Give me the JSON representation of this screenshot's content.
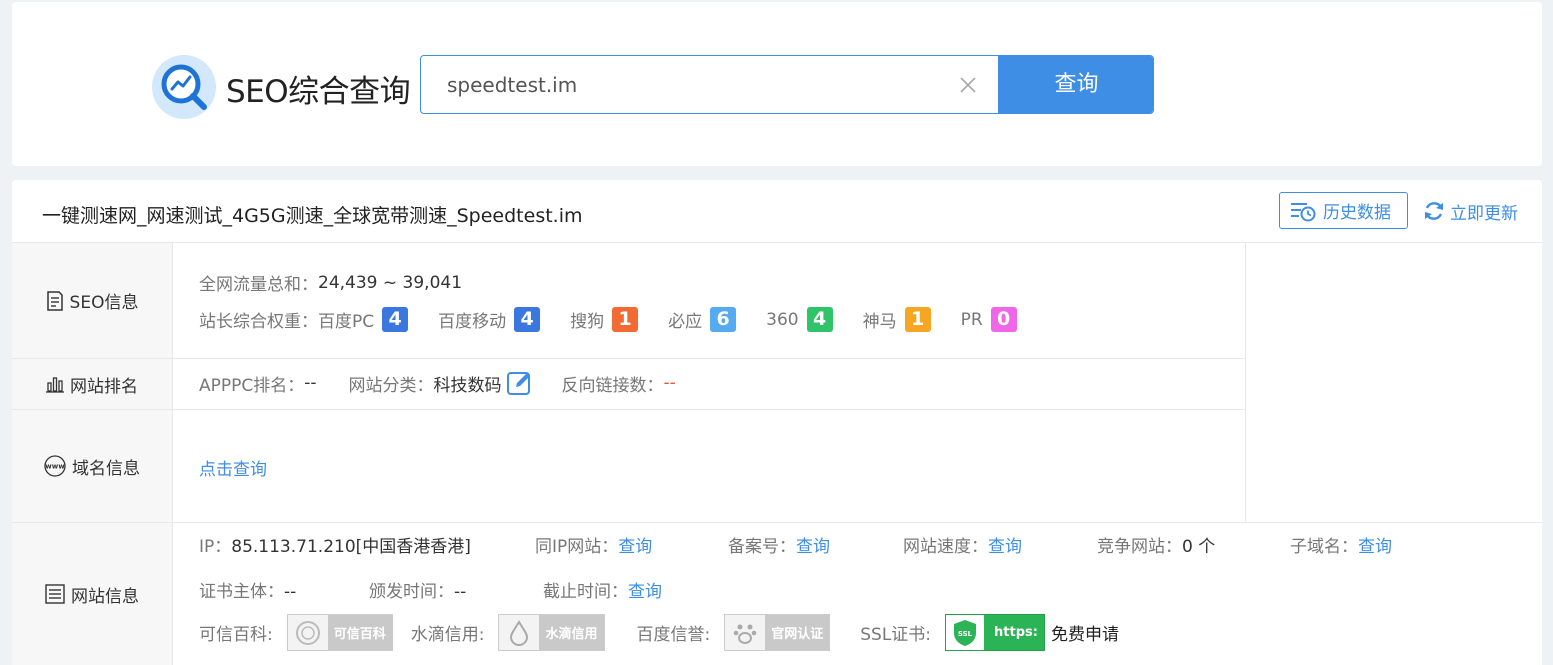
{
  "header": {
    "brand": "SEO综合查询",
    "search_value": "speedtest.im",
    "search_button": "查询"
  },
  "site": {
    "title": "一键测速网_网速测试_4G5G测速_全球宽带测速_Speedtest.im",
    "history_button": "历史数据",
    "refresh_button": "立即更新"
  },
  "seo": {
    "label": "SEO信息",
    "traffic_label": "全网流量总和：",
    "traffic_value": "24,439 ~ 39,041",
    "weight_label": "站长综合权重：",
    "weights": [
      {
        "name": "百度PC",
        "value": "4",
        "color": "#3a78e0"
      },
      {
        "name": "百度移动",
        "value": "4",
        "color": "#3a78e0"
      },
      {
        "name": "搜狗",
        "value": "1",
        "color": "#f26b35"
      },
      {
        "name": "必应",
        "value": "6",
        "color": "#56aaf0"
      },
      {
        "name": "360",
        "value": "4",
        "color": "#2fc467"
      },
      {
        "name": "神马",
        "value": "1",
        "color": "#f6a623"
      },
      {
        "name": "PR",
        "value": "0",
        "color": "#f066e9"
      }
    ]
  },
  "ranking": {
    "label": "网站排名",
    "apppc_label": "APPPC排名：",
    "apppc_value": "--",
    "category_label": "网站分类：",
    "category_value": "科技数码",
    "backlinks_label": "反向链接数：",
    "backlinks_value": "--"
  },
  "domain": {
    "label": "域名信息",
    "link": "点击查询"
  },
  "website": {
    "label": "网站信息",
    "ip_label": "IP：",
    "ip_value": "85.113.71.210[中国香港香港]",
    "same_ip_label": "同IP网站：",
    "same_ip_link": "查询",
    "icp_label": "备案号：",
    "icp_link": "查询",
    "speed_label": "网站速度：",
    "speed_link": "查询",
    "competitor_label": "竞争网站：",
    "competitor_value": "0 个",
    "subdomain_label": "子域名：",
    "subdomain_link": "查询",
    "cert_subject_label": "证书主体：",
    "cert_subject_value": "--",
    "issue_label": "颁发时间：",
    "issue_value": "--",
    "expire_label": "截止时间：",
    "expire_link": "查询",
    "kexin_label": "可信百科:",
    "kexin_badge": "可信百科",
    "shuidi_label": "水滴信用:",
    "shuidi_badge": "水滴信用",
    "baidu_label": "百度信誉:",
    "baidu_badge": "官网认证",
    "ssl_label": "SSL证书:",
    "ssl_badge": "https:",
    "ssl_free": "免费申请"
  }
}
